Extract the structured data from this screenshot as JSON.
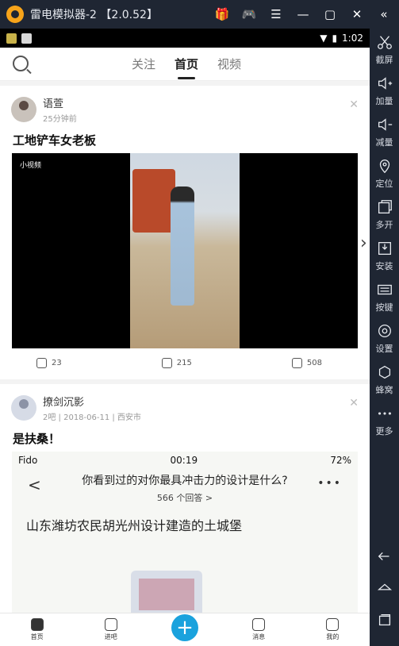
{
  "emulator": {
    "title": "雷电模拟器-2 【2.0.52】",
    "window_buttons": [
      "gift-icon",
      "gamepad-icon",
      "menu-icon",
      "minimize-icon",
      "maximize-icon",
      "close-icon",
      "collapse-icon"
    ],
    "sidebar": [
      {
        "label": "截屏",
        "icon": "scissors-icon"
      },
      {
        "label": "加量",
        "icon": "volume-up-icon"
      },
      {
        "label": "减量",
        "icon": "volume-down-icon"
      },
      {
        "label": "定位",
        "icon": "location-icon"
      },
      {
        "label": "多开",
        "icon": "multi-window-icon"
      },
      {
        "label": "安装",
        "icon": "apk-install-icon"
      },
      {
        "label": "按键",
        "icon": "keyboard-icon"
      },
      {
        "label": "设置",
        "icon": "gear-icon"
      },
      {
        "label": "蜂窝",
        "icon": "hive-icon"
      },
      {
        "label": "更多",
        "icon": "more-icon"
      }
    ]
  },
  "status": {
    "time": "1:02"
  },
  "topnav": {
    "tabs": [
      "关注",
      "首页",
      "视频"
    ],
    "active": 1
  },
  "posts": [
    {
      "user": "语萱",
      "meta": "25分钟前",
      "title": "工地铲车女老板",
      "media_tag": "小视频",
      "actions": [
        "23",
        "215",
        "508"
      ]
    },
    {
      "user": "撩剑沉影",
      "meta": "2吧  |  2018-06-11  |  西安市",
      "title": "是扶桑！",
      "screenshot": {
        "carrier": "Fido",
        "time": "00:19",
        "battery": "72%",
        "question": "你看到过的对你最具冲击力的设计是什么?",
        "answers": "566 个回答 >",
        "headline": "山东潍坊农民胡光州设计建造的土城堡"
      }
    }
  ],
  "bottombar": [
    {
      "label": "首页",
      "icon": "home-icon"
    },
    {
      "label": "进吧",
      "icon": "enter-icon"
    },
    {
      "label": "",
      "icon": "plus-icon"
    },
    {
      "label": "消息",
      "icon": "bell-icon"
    },
    {
      "label": "我的",
      "icon": "user-icon"
    }
  ]
}
